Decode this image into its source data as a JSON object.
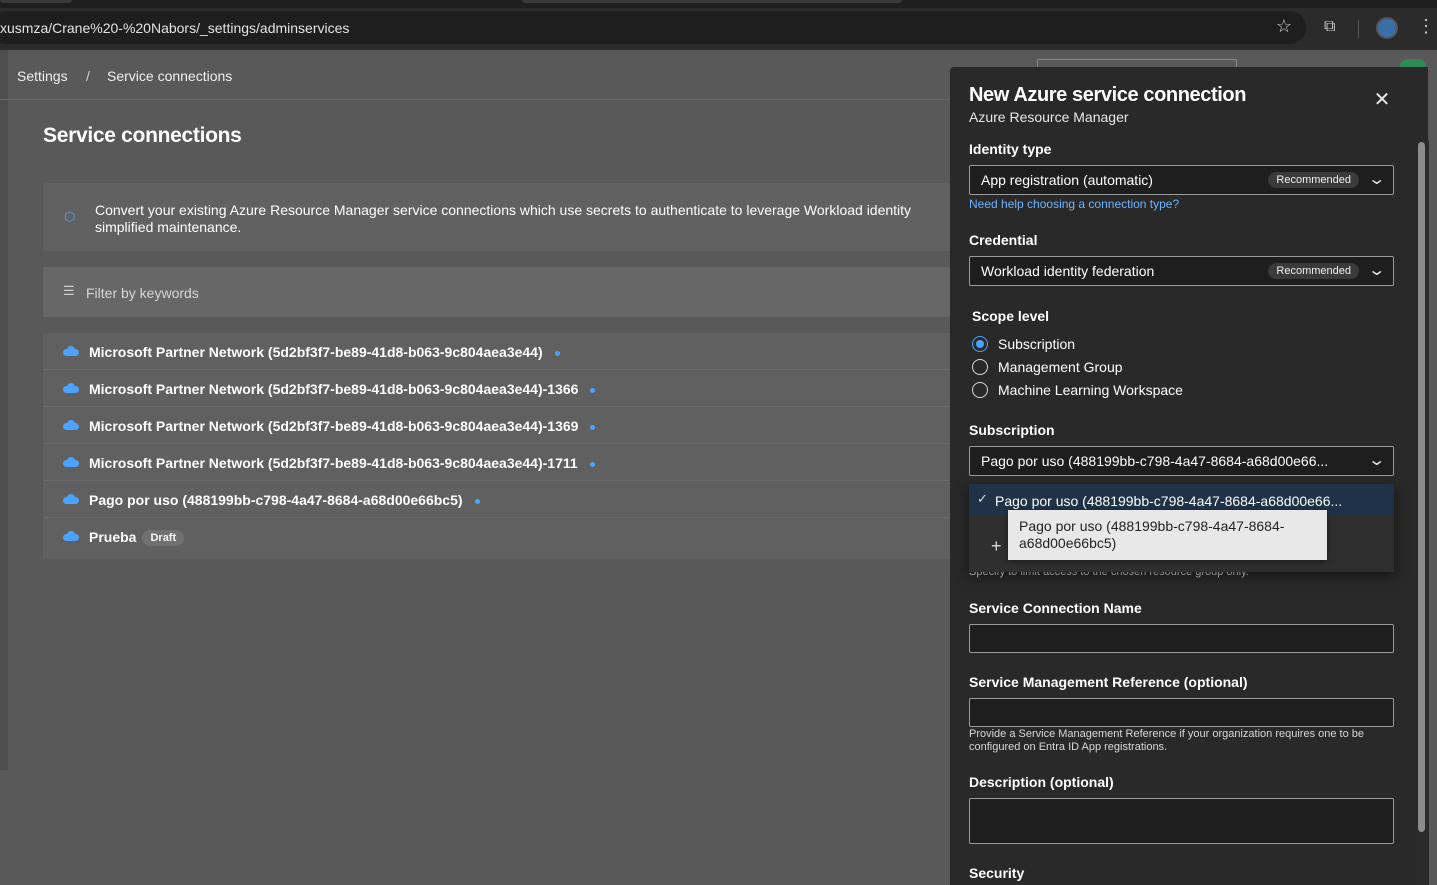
{
  "browser": {
    "url": "xusmza/Crane%20-%20Nabors/_settings/adminservices"
  },
  "breadcrumb": {
    "items": [
      "Settings",
      "Service connections"
    ],
    "separator": "/"
  },
  "page": {
    "title": "Service connections",
    "banner_text": "Convert your existing Azure Resource Manager service connections which use secrets to authenticate to leverage Workload identity\nsimplified maintenance.",
    "filter_placeholder": "Filter by keywords"
  },
  "connections": [
    {
      "name": "Microsoft Partner Network (5d2bf3f7-be89-41d8-b063-9c804aea3e44)",
      "status": "dot"
    },
    {
      "name": "Microsoft Partner Network (5d2bf3f7-be89-41d8-b063-9c804aea3e44)-1366",
      "status": "dot"
    },
    {
      "name": "Microsoft Partner Network (5d2bf3f7-be89-41d8-b063-9c804aea3e44)-1369",
      "status": "dot"
    },
    {
      "name": "Microsoft Partner Network (5d2bf3f7-be89-41d8-b063-9c804aea3e44)-1711",
      "status": "dot"
    },
    {
      "name": "Pago por uso (488199bb-c798-4a47-8684-a68d00e66bc5)",
      "status": "dot"
    },
    {
      "name": "Prueba",
      "status": "draft",
      "badge": "Draft"
    }
  ],
  "panel": {
    "title": "New Azure service connection",
    "subtitle": "Azure Resource Manager",
    "close_icon": "close-icon",
    "identity_type": {
      "label": "Identity type",
      "value": "App registration (automatic)",
      "badge": "Recommended",
      "help_link": "Need help choosing a connection type?"
    },
    "credential": {
      "label": "Credential",
      "value": "Workload identity federation",
      "badge": "Recommended"
    },
    "scope_level": {
      "label": "Scope level",
      "options": [
        "Subscription",
        "Management Group",
        "Machine Learning Workspace"
      ],
      "selected": "Subscription"
    },
    "subscription": {
      "label": "Subscription",
      "value": "Pago por uso (488199bb-c798-4a47-8684-a68d00e66...",
      "dropdown_option": "Pago por uso (488199bb-c798-4a47-8684-a68d00e66...",
      "new_option_partial": "ription",
      "tooltip": "Pago por uso (488199bb-c798-4a47-8684-a68d00e66bc5)",
      "hint_partial": "Specify to limit access to the chosen resource group only."
    },
    "service_connection_name": {
      "label": "Service Connection Name",
      "value": ""
    },
    "service_management_reference": {
      "label": "Service Management Reference (optional)",
      "value": "",
      "hint": "Provide a Service Management Reference if your organization requires one to be configured on Entra ID App registrations."
    },
    "description": {
      "label": "Description (optional)",
      "value": ""
    },
    "security_label": "Security"
  },
  "colors": {
    "accent": "#4aa3ff",
    "link": "#6cb4ff",
    "panel_bg": "#292929"
  }
}
